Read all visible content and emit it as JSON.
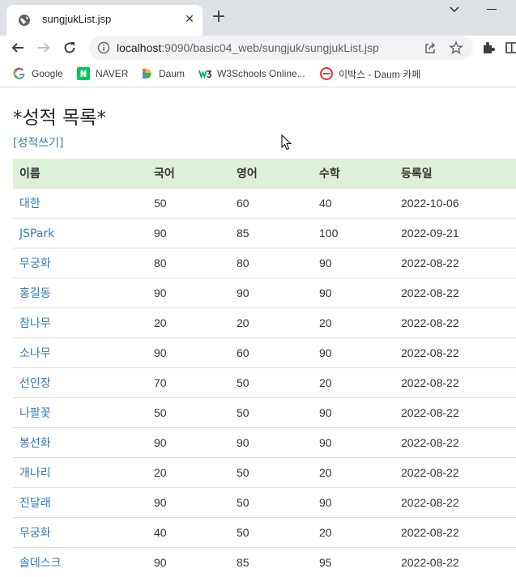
{
  "browser": {
    "tab_title": "sungjukList.jsp",
    "url_host": "localhost",
    "url_rest": ":9090/basic04_web/sungjuk/sungjukList.jsp"
  },
  "bookmarks": [
    {
      "label": "Google",
      "icon": "google-icon"
    },
    {
      "label": "NAVER",
      "icon": "naver-icon"
    },
    {
      "label": "Daum",
      "icon": "daum-icon"
    },
    {
      "label": "W3Schools Online...",
      "icon": "w3schools-icon"
    },
    {
      "label": "이박스 - Daum 카페",
      "icon": "daum-cafe-icon"
    }
  ],
  "page": {
    "title": "*성적 목록*",
    "write_link": "[성적쓰기]"
  },
  "table": {
    "headers": [
      "이름",
      "국어",
      "영어",
      "수학",
      "등록일"
    ],
    "rows": [
      [
        "대한",
        "50",
        "60",
        "40",
        "2022-10-06"
      ],
      [
        "JSPark",
        "90",
        "85",
        "100",
        "2022-09-21"
      ],
      [
        "무궁화",
        "80",
        "80",
        "90",
        "2022-08-22"
      ],
      [
        "홍길동",
        "90",
        "90",
        "90",
        "2022-08-22"
      ],
      [
        "참나무",
        "20",
        "20",
        "20",
        "2022-08-22"
      ],
      [
        "소나무",
        "90",
        "60",
        "90",
        "2022-08-22"
      ],
      [
        "선인장",
        "70",
        "50",
        "20",
        "2022-08-22"
      ],
      [
        "나팔꽃",
        "50",
        "50",
        "90",
        "2022-08-22"
      ],
      [
        "봉선화",
        "90",
        "90",
        "90",
        "2022-08-22"
      ],
      [
        "개나리",
        "20",
        "50",
        "20",
        "2022-08-22"
      ],
      [
        "진달래",
        "90",
        "50",
        "90",
        "2022-08-22"
      ],
      [
        "무궁화",
        "40",
        "50",
        "20",
        "2022-08-22"
      ],
      [
        "솔데스크",
        "90",
        "85",
        "95",
        "2022-08-22"
      ]
    ]
  },
  "colors": {
    "header_bg": "#dff0d8",
    "link": "#337ab7"
  }
}
